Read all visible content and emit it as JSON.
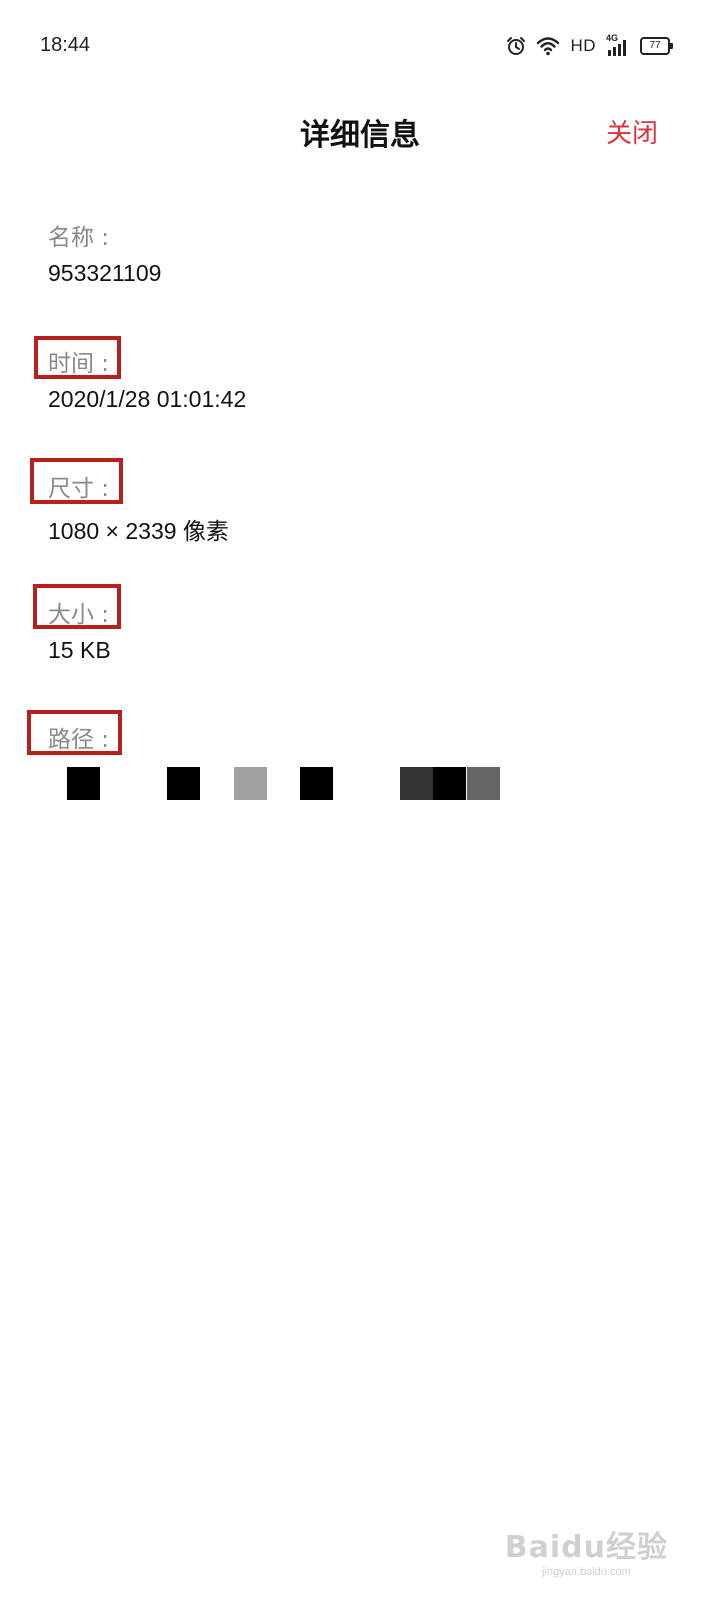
{
  "status_bar": {
    "time": "18:44",
    "icons": [
      "alarm-icon",
      "wifi-icon",
      "hd-indicator",
      "4g-signal-icon",
      "battery-icon"
    ],
    "hd_label": "HD",
    "network_label": "4G",
    "battery_level": "77"
  },
  "header": {
    "title": "详细信息",
    "close_label": "关闭",
    "accent_color": "#d9333f"
  },
  "details": {
    "name_label": "名称 :",
    "name_value": "953321109",
    "time_label": "时间 :",
    "time_value": "2020/1/28 01:01:42",
    "size_label": "尺寸 :",
    "size_value": "1080 × 2339 像素",
    "filesize_label": "大小 :",
    "filesize_value": "15 KB",
    "path_label": "路径 :",
    "path_value_obscured": true
  },
  "annotation_color": "#b7201c",
  "watermark": {
    "logo": "Baidu经验",
    "url": "jingyan.baidu.com"
  }
}
